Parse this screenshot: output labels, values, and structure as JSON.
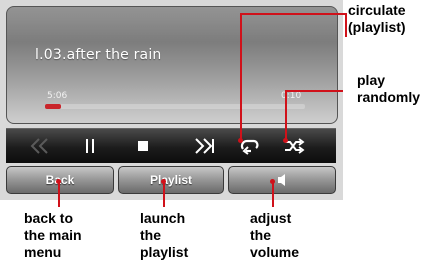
{
  "player": {
    "track_title": "l.03.after the rain",
    "time_current": "5:06",
    "time_total": "0:10",
    "progress": 0.06
  },
  "controls": {
    "icons": [
      "rewind-icon",
      "pause-icon",
      "stop-icon",
      "fast-forward-icon",
      "repeat-icon",
      "shuffle-icon"
    ]
  },
  "buttons": {
    "back": "Back",
    "playlist": "Playlist",
    "volume_icon": "speaker-icon"
  },
  "callouts": {
    "circulate": "circulate\n(playlist)",
    "random": "play\nrandomly",
    "back": "back to\nthe main\nmenu",
    "launch": "launch\nthe\nplaylist",
    "volume": "adjust\nthe\nvolume"
  },
  "colors": {
    "accent": "#d0111a",
    "progress": "#c9252b"
  }
}
